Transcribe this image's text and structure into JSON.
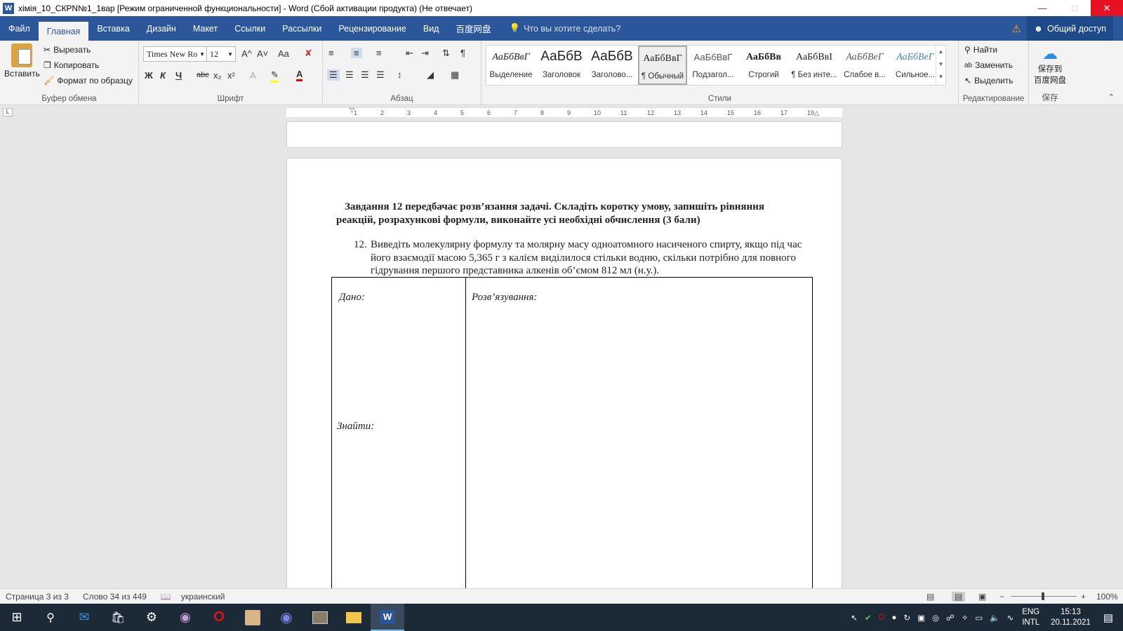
{
  "window": {
    "title": "хімія_10_СКРN№1_1вар [Режим ограниченной функциональности] - Word (Сбой активации продукта) (Не отвечает)",
    "app_icon": "W"
  },
  "ribbon_tabs": [
    "Файл",
    "Главная",
    "Вставка",
    "Дизайн",
    "Макет",
    "Ссылки",
    "Рассылки",
    "Рецензирование",
    "Вид",
    "百度网盘"
  ],
  "tell_me": "Что вы хотите сделать?",
  "share_label": "Общий доступ",
  "clipboard": {
    "paste": "Вставить",
    "cut": "Вырезать",
    "copy": "Копировать",
    "format_painter": "Формат по образцу",
    "group_label": "Буфер обмена"
  },
  "font": {
    "name": "Times New Ro",
    "size": "12",
    "group_label": "Шрифт",
    "bold": "Ж",
    "italic": "К",
    "underline": "Ч",
    "strike": "abc",
    "sub": "x₂",
    "sup": "x²",
    "grow": "A^",
    "shrink": "A˅",
    "case": "Aa"
  },
  "paragraph_label": "Абзац",
  "styles": {
    "group_label": "Стили",
    "items": [
      {
        "preview": "АаБбВвГ",
        "name": "Выделение"
      },
      {
        "preview": "АаБбВ",
        "name": "Заголовок"
      },
      {
        "preview": "АаБбВ",
        "name": "Заголово..."
      },
      {
        "preview": "АаБбВвГ",
        "name": "¶ Обычный"
      },
      {
        "preview": "АаБбВвГ",
        "name": "Подзагол..."
      },
      {
        "preview": "АаБбВв",
        "name": "Строгий"
      },
      {
        "preview": "АаБбВвI",
        "name": "¶ Без инте..."
      },
      {
        "preview": "АаБбВеГ",
        "name": "Слабое в..."
      },
      {
        "preview": "АаБбВеГ",
        "name": "Сильное..."
      }
    ]
  },
  "editing": {
    "find": "Найти",
    "replace": "Заменить",
    "select": "Выделить",
    "group_label": "Редактирование"
  },
  "baidu": {
    "save": "保存到",
    "save2": "百度网盘",
    "group_label": "保存"
  },
  "ruler_marks": [
    "1",
    "2",
    "3",
    "4",
    "5",
    "6",
    "7",
    "8",
    "9",
    "10",
    "11",
    "12",
    "13",
    "14",
    "15",
    "16",
    "17",
    "19"
  ],
  "document": {
    "heading": "Завдання 12 передбачає розв’язання задачі. Складіть коротку умову, запишіть рівняння реакцій, розрахункові формули, виконайте усі необхідні обчислення (3 бали)",
    "item_number": "12.",
    "item_text": "Виведіть молекулярну формулу та молярну масу одноатомного насиченого спирту, якщо під час його взаємодії масою 5,365 г з калієм виділилося стільки водню, скільки потрібно для повного гідрування першого представника алкенів об’ємом 812 мл (н.у.).",
    "given": "Дано:",
    "find": "Знайти:",
    "solution": "Розв’язування:"
  },
  "status": {
    "page": "Страница 3 из 3",
    "words": "Слово 34 из 449",
    "language": "украинский",
    "zoom": "100%"
  },
  "tray": {
    "lang1": "ENG",
    "lang2": "INTL",
    "time": "15:13",
    "date": "20.11.2021"
  },
  "colors": {
    "accent": "#2b579a",
    "taskbar": "#1c2a38",
    "close": "#e81123"
  }
}
